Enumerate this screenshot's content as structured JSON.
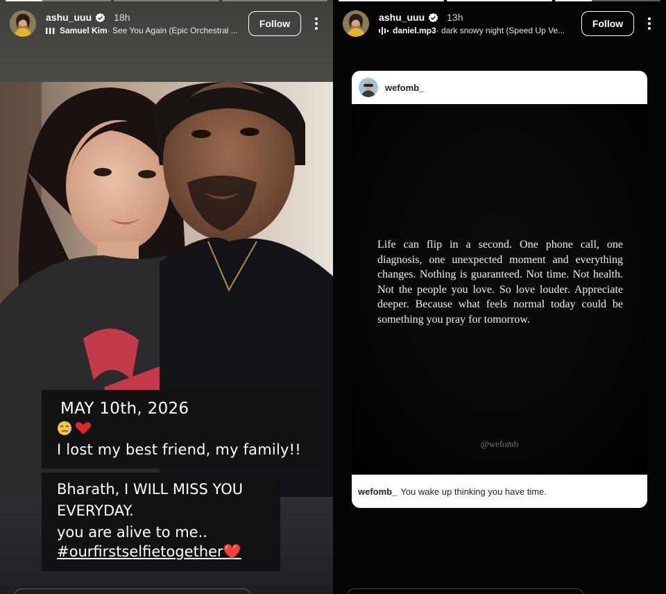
{
  "stories": [
    {
      "username": "ashu_uuu",
      "time": "18h",
      "music_artist": "Samuel Kim",
      "music_song": "· See You Again (Epic Orchestral ...",
      "follow_label": "Follow",
      "caption_date": "MAY 10th, 2026",
      "caption_emoji": "😢❤️",
      "caption_line": "I lost my best friend, my family!!",
      "caption2_lines": [
        "Bharath, I WILL MISS YOU",
        "EVERYDAY.",
        "you are alive to me.."
      ],
      "caption2_hashtag": "#ourfirstselfietogether❤️"
    },
    {
      "username": "ashu_uuu",
      "time": "13h",
      "music_artist": "daniel.mp3",
      "music_song": "· dark snowy night (Speed Up Ve...",
      "follow_label": "Follow",
      "post_username": "wefomb_",
      "quote": "Life can flip in a second. One phone call, one diagnosis, one unexpected moment and everything changes. Nothing is guaranteed. Not time. Not health. Not the people you love. So love louder. Appreciate deeper. Because what feels normal today could be something you pray for tomorrow.",
      "watermark": "@wefomb",
      "footer_username": "wefomb_",
      "footer_caption": "You wake up thinking you have time."
    }
  ],
  "icons": {
    "verified": "verified-badge-icon",
    "music": "music-bars-icon",
    "more": "more-vertical-icon"
  },
  "colors": {
    "verified": "#3897f0",
    "card_bg": "#000000",
    "card_bar": "#ffffff"
  }
}
